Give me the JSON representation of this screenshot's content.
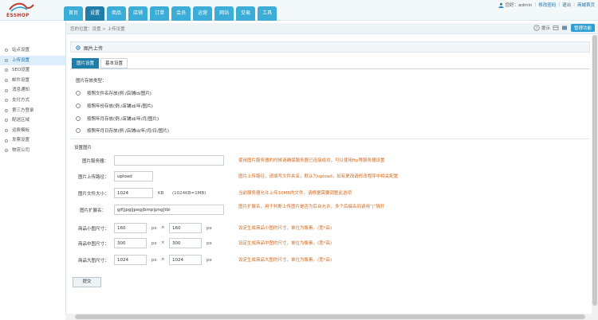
{
  "header": {
    "logo_text": "ESSHOP",
    "nav_tabs": [
      "首页",
      "设置",
      "商品",
      "店铺",
      "订单",
      "会员",
      "运营",
      "网站",
      "交易",
      "工具"
    ],
    "active_tab": "设置",
    "user_label": "您好：admin",
    "links": [
      "修改密码",
      "退出",
      "商城首页"
    ]
  },
  "breadcrumb": "您的位置：设置 > 上传设置",
  "toolbar": {
    "tips_label": "提示",
    "func_button": "管理功能"
  },
  "sidebar": {
    "items": [
      "站点设置",
      "上传设置",
      "SEO设置",
      "邮件设置",
      "消息通知",
      "支付方式",
      "第三方登录",
      "配送区域",
      "运费模板",
      "发票设置",
      "物流公司"
    ],
    "active_index": 1
  },
  "panel": {
    "title": "图片上传",
    "subtabs": [
      "图片设置",
      "基本设置"
    ],
    "active_subtab": 0,
    "dir_section_label": "图片存放类型：",
    "radio_options": [
      "按照文件名存放(例:/店铺id/图片)",
      "按照年份存放(例:/店铺id/年/图片)",
      "按照年月存放(例:/店铺id/年/月/图片)",
      "按照年月日存放(例:/店铺id/年/月/日/图片)"
    ],
    "settings_label": "设置图片",
    "fields": {
      "server_label": "图片服务器：",
      "server_value": "",
      "server_hint": "使用图片服务器的时候请确保服务器已连接成功，可以使用ftp等服务器设置",
      "path_label": "图片上传路径：",
      "path_value": "upload",
      "path_hint": "图片上传路径，请填写文件夹名，默认为upload，如有更改请修改程序中相关配置",
      "size_label": "图片文件大小：",
      "size_value": "1024",
      "size_unit": "KB",
      "size_note": "(1024KB=1MB)",
      "size_hint": "当前服务器允许上传10MB的文件，请根据需要调整此选项",
      "ext_label": "图片扩展名：",
      "ext_value": "gif|jpg|jpeg|bmp|png|tbi",
      "ext_hint": "图片扩展名，用于判断上传图片是否为后台允许，多个后缀名间请用“|”隔开",
      "small_label": "商品小图尺寸：",
      "small_w": "160",
      "small_h": "160",
      "small_hint": "设定生成商品小图的尺寸，单位为像素。(宽*高)",
      "mid_label": "商品中图尺寸：",
      "mid_w": "300",
      "mid_h": "300",
      "mid_hint": "设定生成商品中图的尺寸，单位为像素。(宽*高)",
      "big_label": "商品大图尺寸：",
      "big_w": "1024",
      "big_h": "1024",
      "big_hint": "设定生成商品大图的尺寸，单位为像素。(宽*高)",
      "px_unit": "px",
      "times": "×"
    },
    "save_button": "提交"
  }
}
